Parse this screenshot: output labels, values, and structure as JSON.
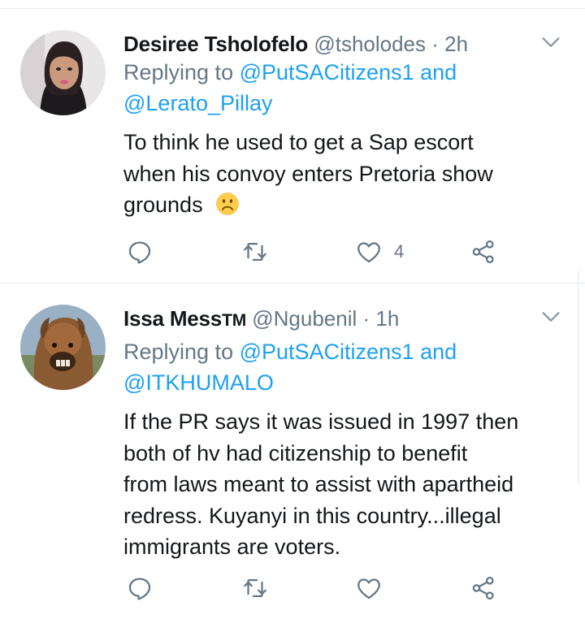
{
  "tweets": [
    {
      "name": "Desiree Tsholofelo",
      "name_suffix": "",
      "handle": "@tsholodes",
      "separator": "·",
      "time": "2h",
      "reply_prefix": "Replying to",
      "mention_1": "@PutSACitizens1",
      "reply_and": "and",
      "mention_2": "@Lerato_Pillay",
      "text_lines": [
        "To think he used to get a Sap escort",
        "when his convoy enters Pretoria show",
        "grounds"
      ],
      "emoji": "☹",
      "actions": {
        "reply_count": "",
        "retweet_count": "",
        "like_count": "4"
      }
    },
    {
      "name": "Issa Mess",
      "name_suffix": "TM",
      "handle": "@Ngubenil",
      "separator": "·",
      "time": "1h",
      "reply_prefix": "Replying to",
      "mention_1": "@PutSACitizens1",
      "reply_and": "and",
      "mention_2": "@ITKHUMALO",
      "text_lines": [
        "If the PR says it was issued in 1997 then",
        "both of hv had citizenship to benefit",
        "from laws meant to assist with apartheid",
        "redress. Kuyanyi in this country...illegal",
        "immigrants are voters."
      ],
      "emoji": "",
      "actions": {
        "reply_count": "",
        "retweet_count": "",
        "like_count": ""
      }
    }
  ],
  "colors": {
    "text": "#14171a",
    "secondary": "#657786",
    "link": "#1da1f2",
    "divider": "#e6ecf0"
  },
  "icons": [
    "chevron-down-icon",
    "reply-icon",
    "retweet-icon",
    "like-icon",
    "share-icon",
    "frowning-face-emoji"
  ]
}
